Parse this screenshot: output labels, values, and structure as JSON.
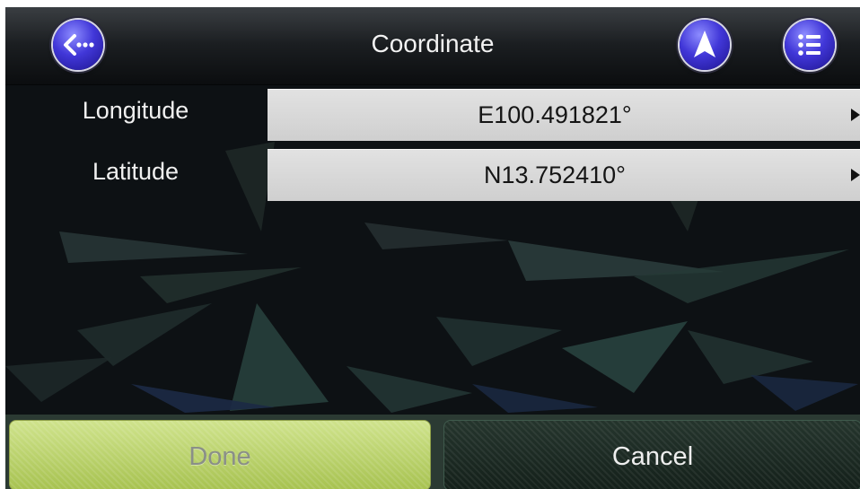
{
  "header": {
    "title": "Coordinate",
    "back_icon": "back-arrow-icon",
    "navigate_icon": "navigation-arrow-icon",
    "menu_icon": "list-menu-icon"
  },
  "rows": [
    {
      "label": "Longitude",
      "value": "E100.491821°"
    },
    {
      "label": "Latitude",
      "value": "N13.752410°"
    }
  ],
  "actions": {
    "done_label": "Done",
    "cancel_label": "Cancel"
  },
  "colors": {
    "accent_button": "#4137d8",
    "done_button": "#bcd46c",
    "cancel_button": "#1e2c25",
    "value_box": "#d8d8d8"
  }
}
